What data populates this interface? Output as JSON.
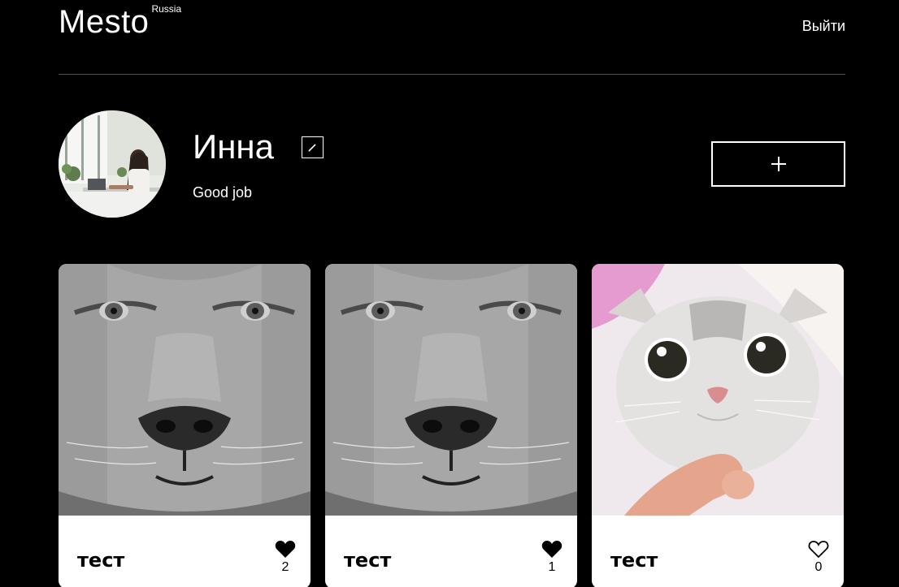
{
  "header": {
    "logo_text": "Mesto",
    "logo_sup": "Russia",
    "logout_label": "Выйти"
  },
  "profile": {
    "name": "Инна",
    "about": "Good job"
  },
  "cards": [
    {
      "title": "тест",
      "likes": "2",
      "liked": true,
      "image": "lion"
    },
    {
      "title": "тест",
      "likes": "1",
      "liked": true,
      "image": "lion"
    },
    {
      "title": "тест",
      "likes": "0",
      "liked": false,
      "image": "cat"
    }
  ],
  "colors": {
    "background": "#000000",
    "card": "#ffffff",
    "text": "#ffffff",
    "divider": "#545454"
  },
  "icons": {
    "edit": "pencil-icon",
    "add": "plus-icon",
    "like": "heart-icon"
  }
}
